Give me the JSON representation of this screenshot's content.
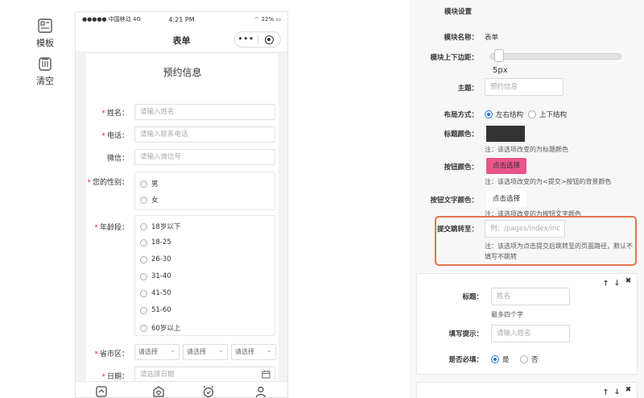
{
  "toolbar": {
    "template_label": "模板",
    "clear_label": "清空"
  },
  "phone": {
    "status": {
      "carrier": "●●●●● 中国移动 4G",
      "time": "4:21 PM",
      "battery": "⌔ 22% ▭"
    },
    "nav_title": "表单",
    "capsule_more": "•••",
    "form_title": "预约信息",
    "fields": [
      {
        "label": "姓名",
        "required": "*",
        "placeholder": "请输入姓名"
      },
      {
        "label": "电话",
        "required": "*",
        "placeholder": "请输入联系电话"
      },
      {
        "label": "微信",
        "required": "",
        "placeholder": "请输入微信号"
      }
    ],
    "gender": {
      "label": "您的性别",
      "required": "*",
      "options": [
        "男",
        "女"
      ]
    },
    "age": {
      "label": "年龄段",
      "required": "*",
      "options": [
        "18岁以下",
        "18-25",
        "26-30",
        "31-40",
        "41-50",
        "51-60",
        "60岁以上"
      ]
    },
    "region": {
      "label": "省市区",
      "required": "*",
      "selects": [
        "请选择",
        "请选择",
        "请选择"
      ]
    },
    "date": {
      "label": "日期",
      "required": "*",
      "placeholder": "请选择日期"
    }
  },
  "settings": {
    "header": "模块设置",
    "module_name_label": "模块名称：",
    "module_name_value": "表单",
    "margin_label": "模块上下边距：",
    "margin_value": "5px",
    "theme_label": "主题：",
    "theme_placeholder": "预约信息",
    "layout_label": "布局方式：",
    "layout_options": [
      "左右结构",
      "上下结构"
    ],
    "title_color_label": "标题颜色：",
    "title_color": "#333333",
    "title_color_note": "注：该选项改变的为标题颜色",
    "button_color_label": "按钮颜色：",
    "button_color": "#e9558c",
    "button_color_pick": "点击选择",
    "button_color_note": "注：该选项改变的为<提交>按钮的背景颜色",
    "button_text_color_label": "按钮文字颜色：",
    "button_text_color_pick": "点击选择",
    "button_text_color_note": "注：该选项改变的为按钮文字颜色",
    "redirect_label": "提交跳转至：",
    "redirect_placeholder": "例：/pages/index/inc",
    "redirect_note": "注：该选项为点击提交后跳转至的页面路径，默认不填写不跳转",
    "sub": {
      "ctrl_up": "🡑",
      "ctrl_down": "🡓",
      "ctrl_close": "✖",
      "title_label": "标题：",
      "title_placeholder": "姓名",
      "title_note": "最多四个字",
      "hint_label": "填写提示：",
      "hint_placeholder": "请输入姓名",
      "required_label": "是否必填：",
      "required_options": [
        "是",
        "否"
      ]
    },
    "sub2_ctrls": {
      "up": "🡑",
      "down": "🡓",
      "close": "✖"
    }
  },
  "colors": {
    "accent": "#1e6fe5",
    "highlight_border": "#e2734a",
    "required": "#e22233"
  }
}
